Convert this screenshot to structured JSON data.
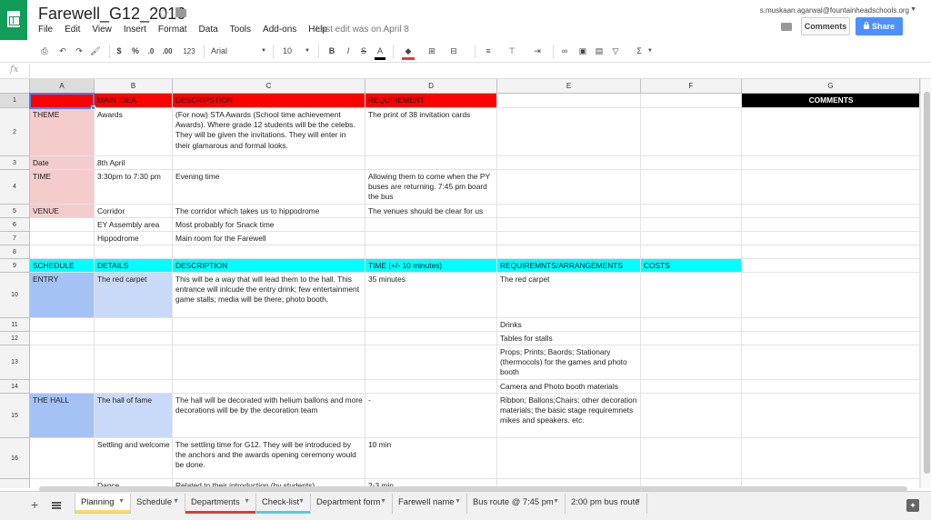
{
  "header": {
    "title": "Farewell_G12_2016",
    "menu": [
      "File",
      "Edit",
      "View",
      "Insert",
      "Format",
      "Data",
      "Tools",
      "Add-ons",
      "Help"
    ],
    "last_edit": "Last edit was on April 8",
    "account_email": "s.muskaan.agarwal@fountainheadschools.org",
    "comments_label": "Comments",
    "share_label": "Share",
    "share_color": "#4d90fe",
    "logo_color": "#0f9d58"
  },
  "toolbar": {
    "currency": "$",
    "percent": "%",
    "decimal_less": ".0",
    "decimal_more": ".00",
    "more_formats": "123",
    "font": "Arial",
    "font_size": "10",
    "bold": "B",
    "italic": "I",
    "strikethrough": "S",
    "text_color": "A",
    "sigma": "Σ"
  },
  "formula_bar": {
    "fx": "fx",
    "value": ""
  },
  "grid": {
    "columns": [
      "A",
      "B",
      "C",
      "D",
      "E",
      "F",
      "G"
    ],
    "selected_column": "A",
    "selected_row": "1",
    "rows": [
      {
        "n": "1",
        "cells": [
          "",
          "MAIN IDEA",
          "DESCRIPSTION",
          "REQUIREMENT",
          "",
          "",
          "COMMENTS"
        ]
      },
      {
        "n": "2",
        "cells": [
          "THEME",
          "Awards",
          "(For now) STA Awards (School time achievement Awards). Where grade 12 students will be the celebs. They will be given the invitations. They will enter in their glamarous and formal looks.",
          "The print of 38 invitation cards",
          "",
          "",
          ""
        ]
      },
      {
        "n": "3",
        "cells": [
          "Date",
          "8th April",
          "",
          "",
          "",
          "",
          ""
        ]
      },
      {
        "n": "4",
        "cells": [
          "TIME",
          "3:30pm to 7:30 pm",
          "Evening time",
          "Allowing them to come when the PY buses are returning. 7:45 pm board the bus",
          "",
          "",
          ""
        ]
      },
      {
        "n": "5",
        "cells": [
          "VENUE",
          "Corridor",
          "The corridor which takes us to hippodrome",
          "The venues should be clear for us and the event. (No one else shoube be there)",
          "",
          "",
          ""
        ]
      },
      {
        "n": "6",
        "cells": [
          "",
          "EY Assembly area",
          "Most probably for Snack time",
          "",
          "",
          "",
          ""
        ]
      },
      {
        "n": "7",
        "cells": [
          "",
          "Hippodrome",
          "Main room for the Farewell",
          "",
          "",
          "",
          ""
        ]
      },
      {
        "n": "8",
        "cells": [
          "",
          "",
          "",
          "",
          "",
          "",
          ""
        ]
      },
      {
        "n": "9",
        "cells": [
          "SCHEDULE",
          "DETAILS",
          "DESCRIPTION",
          "TIME (+/- 10 minutes)",
          "REQUIREMNTS/ARRANGEMENTS",
          "COSTS",
          ""
        ]
      },
      {
        "n": "10",
        "cells": [
          "ENTRY",
          "The red carpet",
          "This will be a way that will lead them to the hall. This entrance will inlcude the entry drink; few entertainment game stalls; media will be there; photo booth.",
          "35 minutes",
          "The red carpet",
          "",
          ""
        ]
      },
      {
        "n": "11",
        "cells": [
          "",
          "",
          "",
          "",
          "Drinks",
          "",
          ""
        ]
      },
      {
        "n": "12",
        "cells": [
          "",
          "",
          "",
          "",
          "Tables for stalls",
          "",
          ""
        ]
      },
      {
        "n": "13",
        "cells": [
          "",
          "",
          "",
          "",
          "Props; Prints; Baords; Stationary (thermocols) for the games and photo booth",
          "",
          ""
        ]
      },
      {
        "n": "14",
        "cells": [
          "",
          "",
          "",
          "",
          "Camera and Photo booth materials",
          "",
          ""
        ]
      },
      {
        "n": "15",
        "cells": [
          "THE HALL",
          "The hall of fame",
          "The hall will be decorated with helium ballons and more decorations will be by the decoration team",
          "-",
          "Ribbon; Ballons;Chairs; other decoration materials; the basic stage requiremnets mikes and speakers. etc.",
          "",
          ""
        ]
      },
      {
        "n": "16",
        "cells": [
          "",
          "Settling and welcome",
          "The settling time for G12. They will be introduced by the anchors and the awards opening ceremony would be done.",
          "10 min",
          "",
          "",
          ""
        ]
      },
      {
        "n": "17",
        "cells": [
          "",
          "Dance (entertainment",
          "Related to their introduction (by students)",
          "2-3 min",
          "",
          "",
          ""
        ]
      }
    ]
  },
  "tabs": [
    {
      "label": "Planning",
      "active": true,
      "underline": "#ffd966"
    },
    {
      "label": "Schedule",
      "active": false,
      "underline": ""
    },
    {
      "label": "Departments",
      "active": false,
      "underline": "#e53935"
    },
    {
      "label": "Check-list",
      "active": false,
      "underline": "#4dd0e1"
    },
    {
      "label": "Department form",
      "active": false,
      "underline": ""
    },
    {
      "label": "Farewell name",
      "active": false,
      "underline": ""
    },
    {
      "label": "Bus route @ 7:45 pm",
      "active": false,
      "underline": ""
    },
    {
      "label": "2:00 pm bus route",
      "active": false,
      "underline": ""
    }
  ],
  "colors": {
    "red": "#ff0000",
    "pink": "#f4cccc",
    "cyan": "#00ffff",
    "blue_dark": "#a4c2f4",
    "blue_light": "#c9daf8",
    "black": "#000000",
    "selection": "#4285f4"
  },
  "icons": [
    "star-icon",
    "folder-icon",
    "comment-icon",
    "lock-icon",
    "print-icon",
    "undo-icon",
    "redo-icon",
    "paint-format-icon",
    "fill-color-icon",
    "borders-icon",
    "merge-icon",
    "align-icon",
    "valign-icon",
    "wrap-icon",
    "link-icon",
    "comment-add-icon",
    "chart-icon",
    "filter-icon",
    "functions-icon",
    "add-sheet-icon",
    "sheet-list-icon",
    "explore-icon"
  ]
}
